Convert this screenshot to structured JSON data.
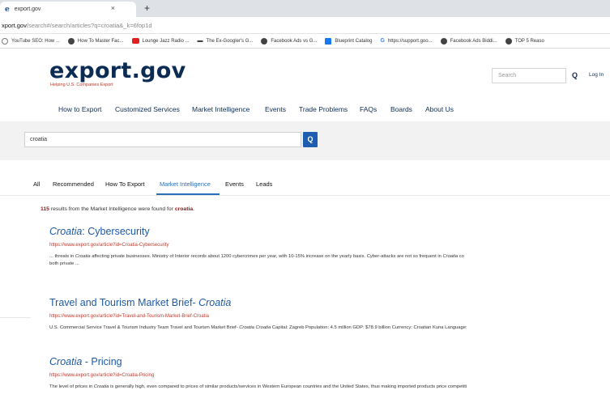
{
  "browser": {
    "tab_title": "export.gov",
    "tab_close": "×",
    "new_tab": "+",
    "url_host": "xport.gov",
    "url_path": "/search#/search/articles?q=croatia&_k=6fop1d",
    "bookmarks": [
      {
        "label": "YouTube SEO: How ...",
        "icon": "ring-icon"
      },
      {
        "label": "How To Master Fac...",
        "icon": "dark-circle-icon"
      },
      {
        "label": "Lounge Jazz Radio ...",
        "icon": "youtube-icon"
      },
      {
        "label": "The Ex-Googler's G...",
        "icon": "tv-icon"
      },
      {
        "label": "Facebook Ads vs G...",
        "icon": "dark-circle-icon"
      },
      {
        "label": "Blueprint Catalog",
        "icon": "facebook-icon"
      },
      {
        "label": "https://support.goo...",
        "icon": "google-icon"
      },
      {
        "label": "Facebook Ads Biddi...",
        "icon": "dark-circle-icon"
      },
      {
        "label": "TOP 5 Reaso",
        "icon": "dark-circle-icon"
      }
    ]
  },
  "site": {
    "logo": "export.gov",
    "tagline": "Helping U.S. Companies Export",
    "search_placeholder": "Search",
    "search_icon": "Q",
    "login": "Log In",
    "nav": [
      "How to Export",
      "Customized Services",
      "Market Intelligence",
      "Events",
      "Trade Problems",
      "FAQs",
      "Boards",
      "About Us"
    ]
  },
  "search": {
    "query": "croatia",
    "button_icon": "Q"
  },
  "facets": [
    "All",
    "Recommended",
    "How To Export",
    "Market Intelligence",
    "Events",
    "Leads"
  ],
  "results_summary": {
    "count": "115",
    "prefix": " results from the Market Intelligence were found for ",
    "term": "croatia",
    "suffix": "."
  },
  "results": [
    {
      "title_italic": "Croatia",
      "title_rest": ": Cybersecurity",
      "url": "https://www.export.gov/article?id=Croatia-Cybersecurity",
      "snippet_a": "... threats in ",
      "snippet_it1": "Croatia",
      "snippet_b": " affecting private businesses. Ministry of Interior records about 1200 cybercrimes per year, with 10-15% increase on the yearly basis. Cyber-attacks are not so frequent in ",
      "snippet_it2": "Croatia",
      "snippet_c": " co",
      "snippet_line2": "both private ..."
    },
    {
      "title_plain": "Travel and Tourism Market Brief- ",
      "title_italic": "Croatia",
      "url": "https://www.export.gov/article?id=Travel-and-Tourism-Market-Brief-Croatia",
      "snippet_a": "U.S. Commercial Service Travel & Tourism Industry Team Travel and Tourism Market Brief- ",
      "snippet_it1": "Croatia Croatia",
      "snippet_b": " Capital: Zagreb Population: 4.5 million GDP: $78.9 billion Currency: Croatian Kuna Language:"
    },
    {
      "title_italic": "Croatia",
      "title_rest": " - Pricing",
      "url": "https://www.export.gov/article?id=Croatia-Pricing",
      "snippet_a": "The level of prices in ",
      "snippet_it1": "Croatia",
      "snippet_b": " is generally high, even compared to prices of similar products/services in Western European countries and the United States, thus making imported products price competiti"
    }
  ]
}
